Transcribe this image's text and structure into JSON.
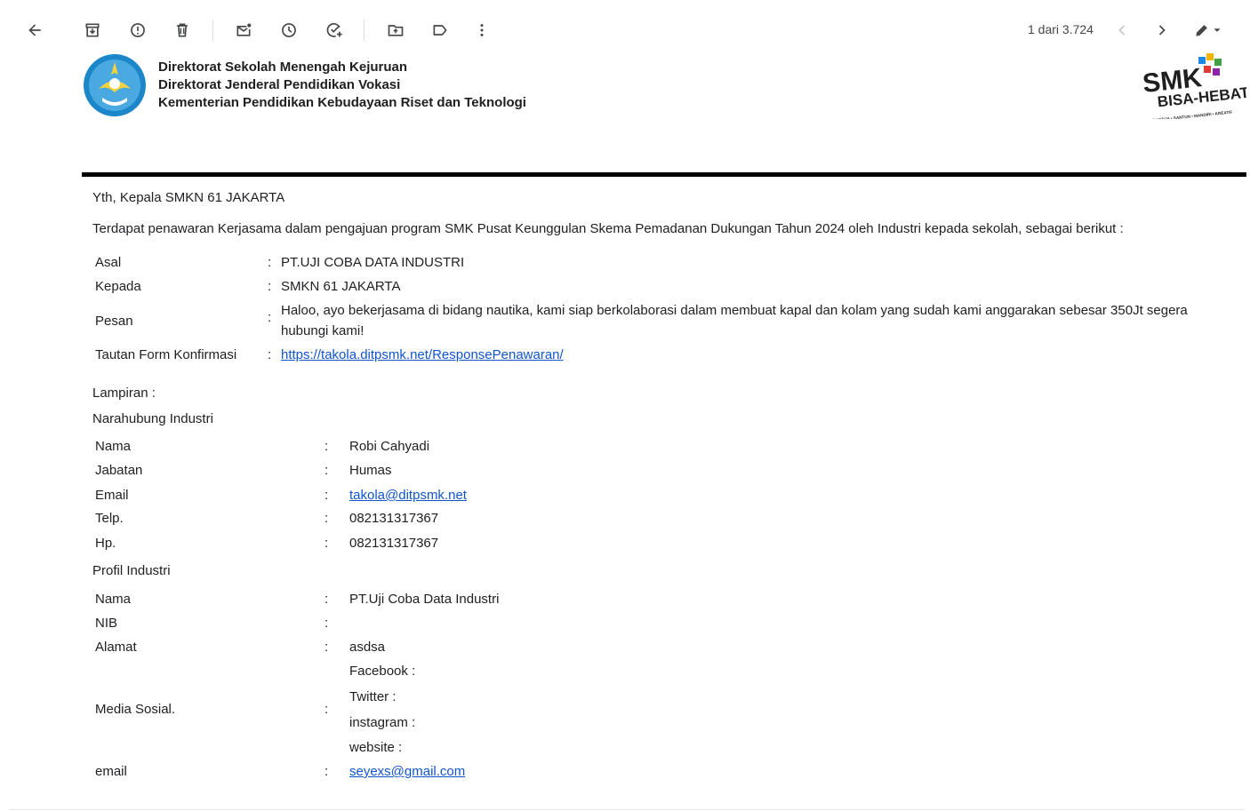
{
  "toolbar": {
    "pager_text": "1 dari 3.724"
  },
  "header": {
    "line1": "Direktorat Sekolah Menengah Kejuruan",
    "line2": "Direktorat Jenderal Pendidikan Vokasi",
    "line3": "Kementerian Pendidikan Kebudayaan Riset dan Teknologi",
    "smk_logo": {
      "word1": "SMK",
      "word2": "BISA-HEBAT",
      "tagline": "SIAP KERJA • SANTUN • MANDIRI • KREATIF"
    }
  },
  "body": {
    "greeting": "Yth, Kepala SMKN 61 JAKARTA",
    "intro": "Terdapat penawaran Kerjasama dalam pengajuan program SMK Pusat Keunggulan Skema Pemadanan Dukungan Tahun 2024 oleh Industri kepada sekolah, sebagai berikut :",
    "offer": {
      "asal_label": "Asal",
      "asal_value": "PT.UJI COBA DATA INDUSTRI",
      "kepada_label": "Kepada",
      "kepada_value": "SMKN 61 JAKARTA",
      "pesan_label": "Pesan",
      "pesan_line1": "Haloo, ayo bekerjasama di bidang nautika, kami siap berkolaborasi dalam membuat kapal dan kolam yang sudah kami anggarakan sebesar 350Jt segera",
      "pesan_line2": "hubungi kami!",
      "tautan_label": "Tautan Form Konfirmasi",
      "tautan_value": "https://takola.ditpsmk.net/ResponsePenawaran/"
    },
    "lampiran": "Lampiran :",
    "contact_heading": "Narahubung Industri",
    "contact": {
      "nama_label": "Nama",
      "nama_value": "Robi Cahyadi",
      "jabatan_label": "Jabatan",
      "jabatan_value": "Humas",
      "email_label": "Email",
      "email_value": "takola@ditpsmk.net",
      "telp_label": "Telp.",
      "telp_value": "082131317367",
      "hp_label": "Hp.",
      "hp_value": "082131317367"
    },
    "profile_heading": "Profil Industri",
    "profile": {
      "nama_label": "Nama",
      "nama_value": "PT.Uji Coba Data Industri",
      "nib_label": "NIB",
      "nib_value": "",
      "alamat_label": "Alamat",
      "alamat_value": "asdsa",
      "media_label": "Media Sosial.",
      "facebook": "Facebook :",
      "twitter": "Twitter :",
      "instagram": "instagram :",
      "website": "website :",
      "email_label": "email",
      "email_value": "seyexs@gmail.com"
    },
    "colon": ":"
  },
  "colors": {
    "link": "#1155cc",
    "text": "#202124",
    "rule": "#000000"
  }
}
